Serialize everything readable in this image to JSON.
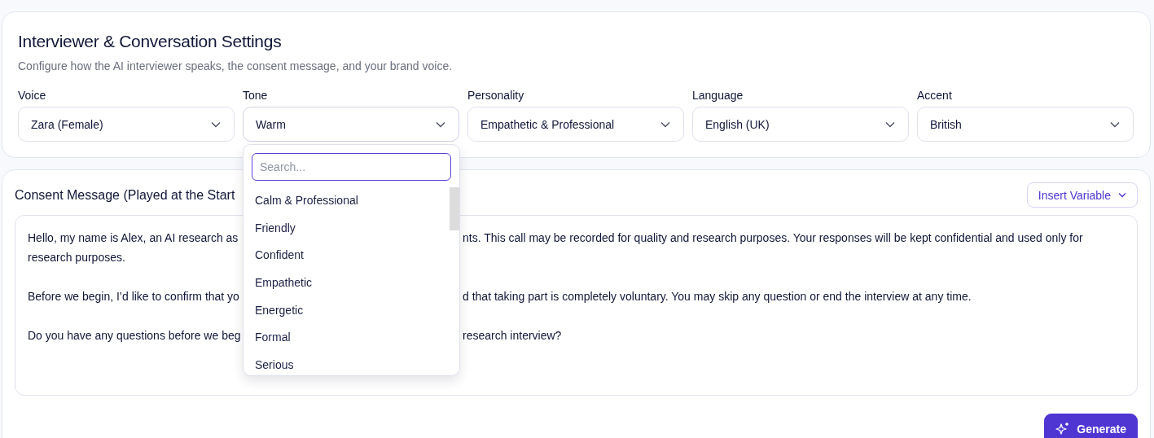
{
  "settings": {
    "title": "Interviewer & Conversation Settings",
    "subtitle": "Configure how the AI interviewer speaks, the consent message, and your brand voice.",
    "fields": [
      {
        "label": "Voice",
        "value": "Zara (Female)",
        "expanded": false
      },
      {
        "label": "Tone",
        "value": "Warm",
        "expanded": true,
        "search_placeholder": "Search...",
        "options": [
          "Calm & Professional",
          "Friendly",
          "Confident",
          "Empathetic",
          "Energetic",
          "Formal",
          "Serious"
        ]
      },
      {
        "label": "Personality",
        "value": "Empathetic & Professional",
        "expanded": false
      },
      {
        "label": "Language",
        "value": "English (UK)",
        "expanded": false
      },
      {
        "label": "Accent",
        "value": "British",
        "expanded": false
      }
    ]
  },
  "consent": {
    "title": "Consent Message (Played at the Start",
    "insert_button": "Insert Variable",
    "paragraphs": [
      [
        {
          "left": "Hello, my name is Alex, an AI research as",
          "right": "nts. This call may be recorded for quality and research purposes. Your responses will be kept confidential and used only for"
        },
        {
          "left": "research purposes."
        }
      ],
      [
        {
          "left": "Before we begin, I’d like to confirm that yo",
          "right": "d that taking part is completely voluntary. You may skip any question or end the interview at any time."
        }
      ],
      [
        {
          "left": "Do you have any questions before we beg",
          "right": "research interview?"
        }
      ]
    ],
    "generate_button": "Generate"
  }
}
